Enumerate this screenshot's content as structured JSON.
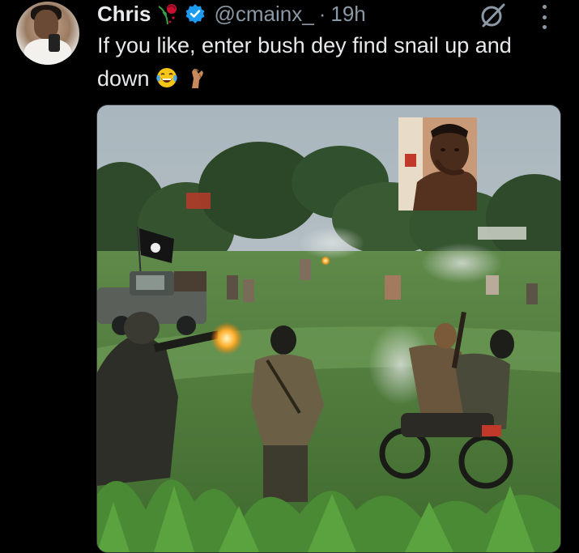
{
  "tweet": {
    "author_name": "Chris",
    "handle": "@cmainx_",
    "separator": "·",
    "time": "19h",
    "text": "If you like, enter bush dey find snail up and down",
    "emojis": [
      "tears-of-joy-emoji",
      "pinched-fingers-emoji"
    ],
    "icons": {
      "name_decoration": "wilted-rose-icon",
      "verified": "verified-badge-icon",
      "grok": "grok-icon",
      "more": "more-dots-icon"
    }
  },
  "media": {
    "type": "photo",
    "inset": "face-reaction-inset",
    "subjects": [
      "armed-riders-on-motorcycles",
      "rifle-muzzle-flash",
      "black-flag",
      "pickup-truck",
      "green-field",
      "trees"
    ]
  },
  "colors": {
    "background": "#000000",
    "primary_text": "#e7e9ea",
    "secondary_text": "#8b98a5",
    "verified_blue": "#1d9bf0"
  }
}
